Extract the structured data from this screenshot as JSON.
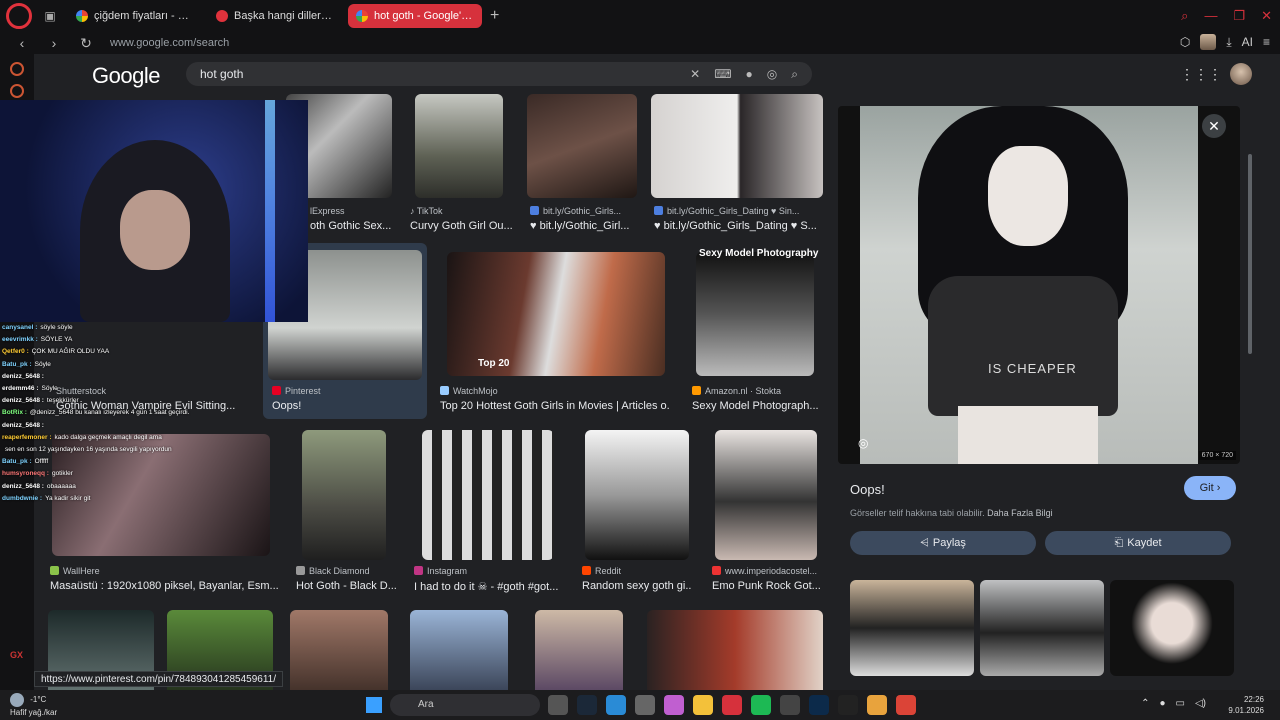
{
  "tabs": [
    {
      "label": "çiğdem fiyatları - Google'da",
      "favicon": "google-icon",
      "active": false
    },
    {
      "label": "Başka hangi dillerde \"fig\"",
      "favicon": "reddit-icon",
      "active": false
    },
    {
      "label": "hot goth - Google'da Ara",
      "favicon": "google-icon",
      "active": true
    }
  ],
  "address": {
    "url": "www.google.com/search",
    "ai_label": "AI"
  },
  "google": {
    "logo": "Google",
    "query": "hot goth"
  },
  "grid": [
    {
      "source": "lExpress",
      "title": "oth Gothic Sex..."
    },
    {
      "source": "TikTok",
      "title": "Curvy Goth Girl Ou..."
    },
    {
      "source": "bit.ly/Gothic_Girls...",
      "title": "♥ bit.ly/Gothic_Girl..."
    },
    {
      "source": "bit.ly/Gothic_Girls_Dating ♥ Sin...",
      "title": "♥ bit.ly/Gothic_Girls_Dating ♥ S..."
    },
    {
      "source": "Shutterstock",
      "title": "Gothic Woman Vampire Evil Sitting..."
    },
    {
      "source": "Pinterest",
      "title": "Oops!"
    },
    {
      "source": "WatchMojo",
      "title": "Top 20 Hottest Goth Girls in Movies | Articles o...",
      "caption": "Top 20"
    },
    {
      "source": "Amazon.nl · Stokta",
      "title": "Sexy Model Photograph...",
      "caption": "Sexy Model Photography"
    },
    {
      "source": "WallHere",
      "title": "Masaüstü : 1920x1080 piksel, Bayanlar, Esm..."
    },
    {
      "source": "Black Diamond",
      "title": "Hot Goth - Black D..."
    },
    {
      "source": "Instagram",
      "title": "I had to do it ☠ - #goth #got..."
    },
    {
      "source": "Reddit",
      "title": "Random sexy goth gi..."
    },
    {
      "source": "www.imperiodacostel...",
      "title": "Emo Punk Rock Got..."
    }
  ],
  "preview": {
    "title": "Oops!",
    "visit_label": "Git",
    "copyright_text": "Görseller telif hakkına tabi olabilir.",
    "more_info": "Daha Fazla Bilgi",
    "share_label": "Paylaş",
    "save_label": "Kaydet",
    "dimensions": "670 × 720",
    "shirt_text": "IS CHEAPER"
  },
  "chat": [
    {
      "user": "canysanel :",
      "msg": "söyle söyle",
      "color": "#7fd3ff"
    },
    {
      "user": "eeevrimkk :",
      "msg": "SÖYLE YA",
      "color": "#7fd3ff"
    },
    {
      "user": "Qetfer0 :",
      "msg": "ÇOK MU AĞIR OLDU YAA",
      "color": "#ffcc33"
    },
    {
      "user": "Batu_pk :",
      "msg": "Söyle",
      "color": "#7fd3ff"
    },
    {
      "user": "denizz_5648 :",
      "msg": "",
      "color": "#ffffff"
    },
    {
      "user": "erdemm46 :",
      "msg": "Söyle",
      "color": "#ffffff"
    },
    {
      "user": "denizz_5648 :",
      "msg": "teşekkürler",
      "color": "#ffffff"
    },
    {
      "user": "BotRix :",
      "msg": "@denizz_5648 bu kanalı izleyerek 4 gün 1 saat geçirdi.",
      "color": "#7fff7f"
    },
    {
      "user": "denizz_5648 :",
      "msg": "",
      "color": "#ffffff"
    },
    {
      "user": "reaperfemoner :",
      "msg": "kado dalga geçmek amaçlı degil ama",
      "color": "#ffcc33"
    },
    {
      "user": "",
      "msg": "sen en son 12 yaşındayken 16 yaşında sevgili yapıyordun",
      "color": "#ff8888"
    },
    {
      "user": "Batu_pk :",
      "msg": "Offfff",
      "color": "#7fd3ff"
    },
    {
      "user": "humsyroneqq :",
      "msg": "gotikler",
      "color": "#ff7777"
    },
    {
      "user": "denizz_5648 :",
      "msg": "obaaaaaa",
      "color": "#ffffff"
    },
    {
      "user": "dumbdwnie :",
      "msg": "Ya kadir sikir git",
      "color": "#7fd3ff"
    }
  ],
  "status_url": "https://www.pinterest.com/pin/784893041285459611/",
  "taskbar": {
    "temp": "-1°C",
    "weather": "Hafif yağ./kar",
    "search_label": "Ara",
    "time": "22:26",
    "date": "9.01.2026"
  }
}
